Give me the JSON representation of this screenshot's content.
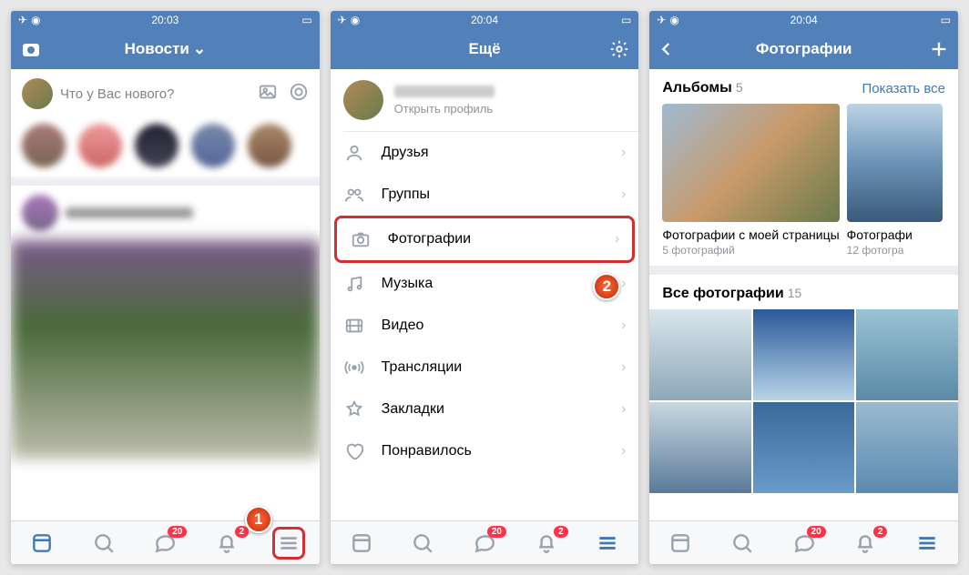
{
  "statusbar": {
    "time1": "20:03",
    "time2": "20:04",
    "time3": "20:04"
  },
  "screen1": {
    "title": "Новости",
    "composer_placeholder": "Что у Вас нового?"
  },
  "screen2": {
    "title": "Ещё",
    "open_profile": "Открыть профиль",
    "menu": {
      "friends": "Друзья",
      "groups": "Группы",
      "photos": "Фотографии",
      "music": "Музыка",
      "video": "Видео",
      "live": "Трансляции",
      "bookmarks": "Закладки",
      "liked": "Понравилось"
    }
  },
  "screen3": {
    "title": "Фотографии",
    "albums_label": "Альбомы",
    "albums_count": "5",
    "show_all": "Показать все",
    "album1_title": "Фотографии с моей страницы",
    "album1_sub": "5 фотографий",
    "album2_title": "Фотографи",
    "album2_sub": "12 фотогра",
    "all_photos_label": "Все фотографии",
    "all_photos_count": "15"
  },
  "tabbar": {
    "badge_messages": "20",
    "badge_notifications": "2"
  },
  "callouts": {
    "c1": "1",
    "c2": "2"
  },
  "colors": {
    "accent": "#5281b9",
    "badge": "#ff3347",
    "highlight": "#d03030"
  }
}
